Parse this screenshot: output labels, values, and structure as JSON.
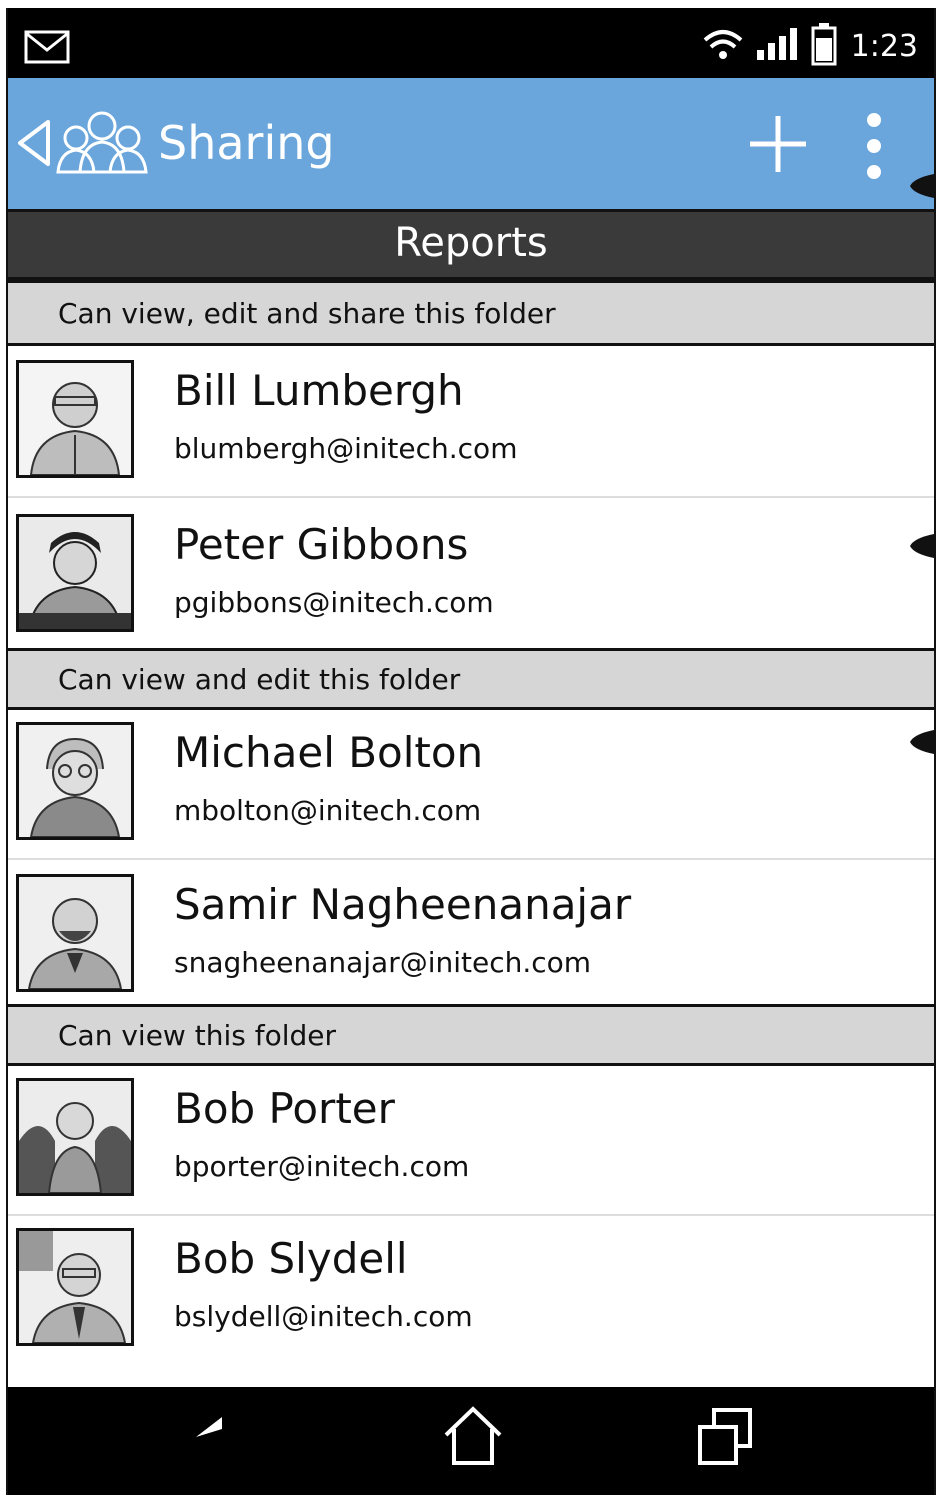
{
  "status_bar": {
    "time": "1:23",
    "icons": [
      "mail-icon",
      "wifi-icon",
      "signal-icon",
      "battery-icon"
    ]
  },
  "action_bar": {
    "title": "Sharing",
    "icons": [
      "back-icon",
      "people-icon",
      "add-icon",
      "overflow-menu-icon"
    ]
  },
  "folder": {
    "title": "Reports"
  },
  "groups": [
    {
      "label": "Can view, edit and share this folder",
      "people": [
        {
          "name": "Bill Lumbergh",
          "email": "blumbergh@initech.com"
        },
        {
          "name": "Peter Gibbons",
          "email": "pgibbons@initech.com"
        }
      ]
    },
    {
      "label": "Can view and edit this folder",
      "people": [
        {
          "name": "Michael Bolton",
          "email": "mbolton@initech.com"
        },
        {
          "name": "Samir Nagheenanajar",
          "email": "snagheenanajar@initech.com"
        }
      ]
    },
    {
      "label": "Can view this folder",
      "people": [
        {
          "name": "Bob Porter",
          "email": "bporter@initech.com"
        },
        {
          "name": "Bob Slydell",
          "email": "bslydell@initech.com"
        }
      ]
    }
  ],
  "nav_bar": {
    "icons": [
      "back-arrow-icon",
      "home-icon",
      "recent-apps-icon"
    ]
  },
  "colors": {
    "action_bar": "#6aa6dc",
    "section_header": "#3a3a3a",
    "group_header": "#d6d6d6",
    "system_bars": "#000000"
  }
}
